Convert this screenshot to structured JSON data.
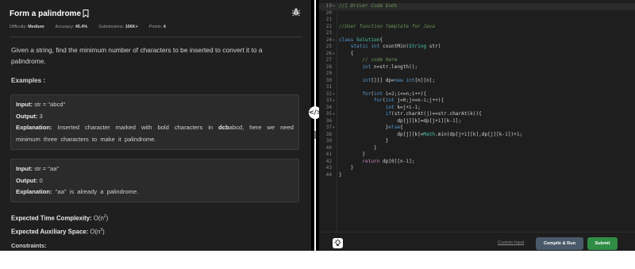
{
  "problem": {
    "title": "Form a palindrome",
    "meta": {
      "difficulty_label": "Difficulty:",
      "difficulty_value": "Medium",
      "accuracy_label": "Accuracy:",
      "accuracy_value": "45.4%",
      "submissions_label": "Submissions:",
      "submissions_value": "106K+",
      "points_label": "Points:",
      "points_value": "4"
    },
    "description": "Given a string, find the minimum number of characters to be inserted to convert it to a palindrome.",
    "examples_heading": "Examples :",
    "example1": {
      "input_label": "Input:",
      "input_value": "str = \"abcd\"",
      "output_label": "Output:",
      "output_value": "3",
      "explanation_label": "Explanation:",
      "explanation_pre": "Inserted character marked with bold characters in",
      "explanation_bold": "dcb",
      "explanation_post": "abcd, here we need minimum three characters to make it palindrome."
    },
    "example2": {
      "input_label": "Input:",
      "input_value": "str = \"aa\"",
      "output_label": "Output:",
      "output_value": "0",
      "explanation_label": "Explanation:",
      "explanation_text": "\"aa\" is already a palindrome."
    },
    "time_label": "Expected Time Complexity:",
    "time_value_pre": "O(n",
    "time_value_sup": "2",
    "time_value_post": ")",
    "space_label": "Expected Auxiliary Space:",
    "space_value_pre": "O(n",
    "space_value_sup": "2",
    "space_value_post": ")",
    "constraints_heading": "Constraints:"
  },
  "editor": {
    "lines": [
      {
        "n": "19",
        "t": "//{ Driver Code Ends"
      },
      {
        "n": "20",
        "t": ""
      },
      {
        "n": "21",
        "t": ""
      },
      {
        "n": "22",
        "t": "//User function Template for Java"
      },
      {
        "n": "23",
        "t": ""
      },
      {
        "n": "24",
        "t": "class Solution{"
      },
      {
        "n": "25",
        "t": "    static int countMin(String str)"
      },
      {
        "n": "26",
        "t": "    {"
      },
      {
        "n": "27",
        "t": "        // code here"
      },
      {
        "n": "28",
        "t": "        int n=str.length();"
      },
      {
        "n": "29",
        "t": ""
      },
      {
        "n": "30",
        "t": "        int[][] dp=new int[n][n];"
      },
      {
        "n": "31",
        "t": ""
      },
      {
        "n": "32",
        "t": "        for(int i=2;i<=n;i++){"
      },
      {
        "n": "33",
        "t": "            for(int j=0;j<=n-i;j++){"
      },
      {
        "n": "34",
        "t": "                int k=j+i-1;"
      },
      {
        "n": "35",
        "t": "                if(str.charAt(j)==str.charAt(k)){"
      },
      {
        "n": "36",
        "t": "                    dp[j][k]=dp[j+1][k-1];"
      },
      {
        "n": "37",
        "t": "                }else{"
      },
      {
        "n": "38",
        "t": "                    dp[j][k]=Math.min(dp[j+1][k],dp[j][k-1])+1;"
      },
      {
        "n": "39",
        "t": "                }"
      },
      {
        "n": "40",
        "t": "            }"
      },
      {
        "n": "41",
        "t": "        }"
      },
      {
        "n": "42",
        "t": "        return dp[0][n-1];"
      },
      {
        "n": "43",
        "t": "    }"
      },
      {
        "n": "44",
        "t": "}"
      }
    ]
  },
  "actions": {
    "custom_input": "Custom Input",
    "compile_run": "Compile & Run",
    "submit": "Submit"
  },
  "icons": {
    "bookmark": "bookmark-icon",
    "bug": "bug-icon",
    "drag": "drag-handle-icon",
    "theme": "lightbulb-icon"
  },
  "colors": {
    "panel_bg": "#1f1f1f",
    "editor_bg": "#1e1e1e",
    "submit_green": "#2f8d46",
    "compile_gray": "#4a5a6a"
  }
}
